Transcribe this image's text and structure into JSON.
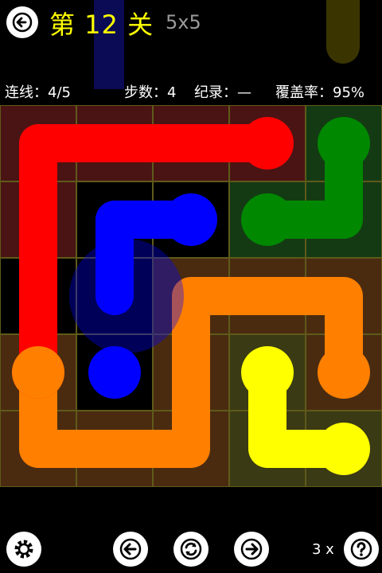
{
  "header": {
    "title": "第 12 关",
    "size": "5x5"
  },
  "status": {
    "flows": "连线：4/5",
    "moves": "步数：4",
    "best": "纪录：—",
    "fill": "覆盖率：95%"
  },
  "board": {
    "grid": 5,
    "colors": {
      "red": "#ff0000",
      "green": "#008800",
      "blue": "#0000ff",
      "orange": "#ff7f00",
      "yellow": "#ffff00",
      "grid_line": "#5f5a1a"
    },
    "flows": [
      {
        "name": "red",
        "color": "#ff0000",
        "tint": "#4a1414",
        "path": [
          [
            0,
            3
          ],
          [
            0,
            1
          ],
          [
            0,
            0
          ],
          [
            1,
            0
          ],
          [
            2,
            0
          ],
          [
            3,
            0
          ]
        ],
        "endpoints": [
          [
            0,
            3
          ],
          [
            3,
            0
          ]
        ]
      },
      {
        "name": "green",
        "color": "#008800",
        "tint": "#143a14",
        "path": [
          [
            4,
            0
          ],
          [
            4,
            1
          ],
          [
            3,
            1
          ]
        ],
        "endpoints": [
          [
            4,
            0
          ],
          [
            3,
            1
          ]
        ]
      },
      {
        "name": "blue",
        "color": "#0000ff",
        "tint": "#000000",
        "path": [
          [
            2,
            1
          ],
          [
            1,
            1
          ],
          [
            1,
            2
          ]
        ],
        "endpoints": [
          [
            2,
            1
          ],
          [
            1,
            3
          ]
        ]
      },
      {
        "name": "orange",
        "color": "#ff7f00",
        "tint": "#4a2b10",
        "path": [
          [
            0,
            3
          ],
          [
            0,
            4
          ],
          [
            1,
            4
          ],
          [
            2,
            4
          ],
          [
            2,
            3
          ],
          [
            2,
            2
          ],
          [
            3,
            2
          ],
          [
            4,
            2
          ],
          [
            4,
            3
          ]
        ],
        "endpoints": [
          [
            0,
            3
          ],
          [
            4,
            3
          ]
        ]
      },
      {
        "name": "yellow",
        "color": "#ffff00",
        "tint": "#3a3a14",
        "path": [
          [
            3,
            3
          ],
          [
            3,
            4
          ],
          [
            4,
            4
          ]
        ],
        "endpoints": [
          [
            3,
            3
          ],
          [
            4,
            4
          ]
        ]
      }
    ]
  },
  "footer": {
    "hint_count": "3 x"
  }
}
